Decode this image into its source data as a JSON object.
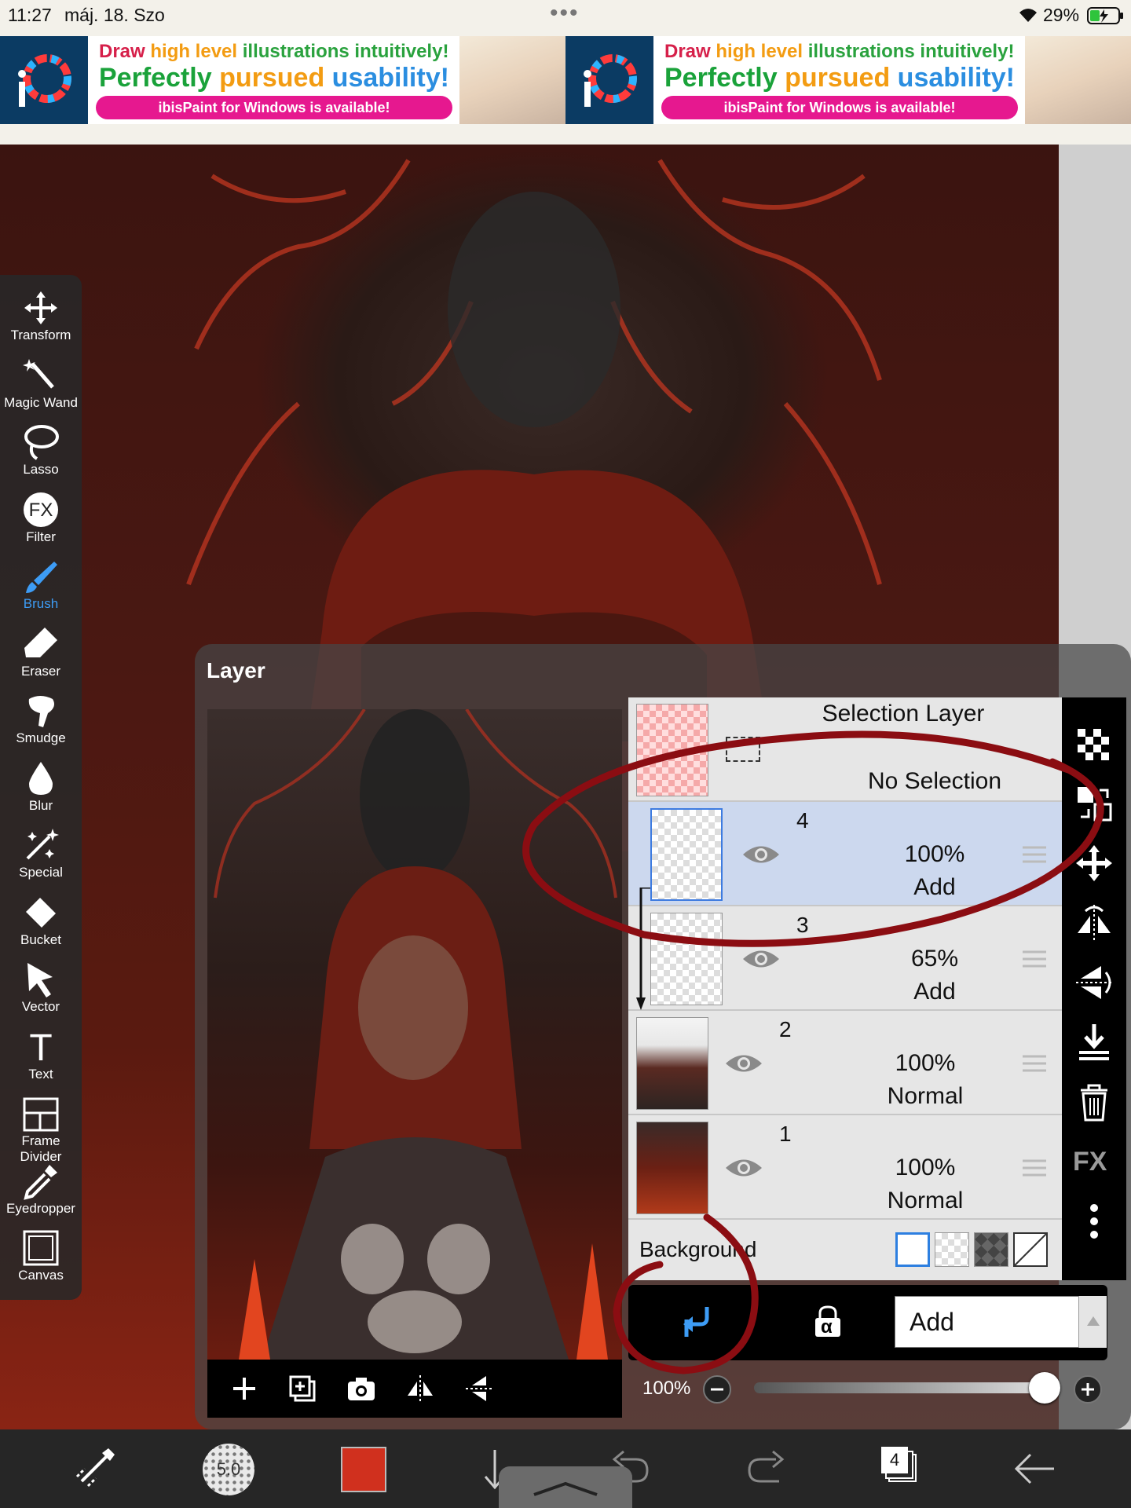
{
  "status_bar": {
    "time": "11:27",
    "date": "máj. 18. Szo",
    "battery": "29%",
    "dots": "•••"
  },
  "ad": {
    "line1_parts": [
      "Draw ",
      "high level ",
      "illustrations ",
      "intuitively!"
    ],
    "line2_parts": [
      "Perfectly ",
      "pursued ",
      "usability!"
    ],
    "pill": "ibisPaint for Windows is available!",
    "logo_letter": "i"
  },
  "toolbar": {
    "tools": [
      {
        "label": "Transform",
        "icon": "transform-icon"
      },
      {
        "label": "Magic Wand",
        "icon": "magic-wand-icon"
      },
      {
        "label": "Lasso",
        "icon": "lasso-icon"
      },
      {
        "label": "Filter",
        "icon": "fx-icon",
        "glyph": "FX"
      },
      {
        "label": "Brush",
        "icon": "brush-icon",
        "active": true
      },
      {
        "label": "Eraser",
        "icon": "eraser-icon"
      },
      {
        "label": "Smudge",
        "icon": "smudge-icon"
      },
      {
        "label": "Blur",
        "icon": "blur-drop-icon"
      },
      {
        "label": "Special",
        "icon": "special-sparkle-icon"
      },
      {
        "label": "Bucket",
        "icon": "bucket-icon"
      },
      {
        "label": "Vector",
        "icon": "vector-arrow-icon"
      },
      {
        "label": "Text",
        "icon": "text-icon",
        "glyph": "T"
      },
      {
        "label": "Frame Divider",
        "icon": "frame-divider-icon"
      },
      {
        "label": "Eyedropper",
        "icon": "eyedropper-icon"
      },
      {
        "label": "Canvas",
        "icon": "canvas-icon"
      }
    ]
  },
  "layer_panel": {
    "title": "Layer",
    "selection_layer": {
      "name": "Selection Layer",
      "status": "No Selection"
    },
    "layers": [
      {
        "number": "4",
        "opacity": "100%",
        "mode": "Add",
        "selected": true,
        "clipped": false
      },
      {
        "number": "3",
        "opacity": "65%",
        "mode": "Add",
        "selected": false,
        "clipped": true
      },
      {
        "number": "2",
        "opacity": "100%",
        "mode": "Normal",
        "selected": false,
        "clipped": false
      },
      {
        "number": "1",
        "opacity": "100%",
        "mode": "Normal",
        "selected": false,
        "clipped": false
      }
    ],
    "background_label": "Background",
    "blend_mode": "Add",
    "opacity_value": "100%",
    "opacity_fraction": 1.0,
    "alpha_glyph": "α",
    "side_fx": "FX"
  },
  "bottom_bar": {
    "brush_size": "5.0",
    "layer_count": "4",
    "color": "#d0301e"
  },
  "colors": {
    "accent": "#3d9cf5",
    "annotation_red": "#8b0d12",
    "selected_row": "#ccd8ee"
  }
}
